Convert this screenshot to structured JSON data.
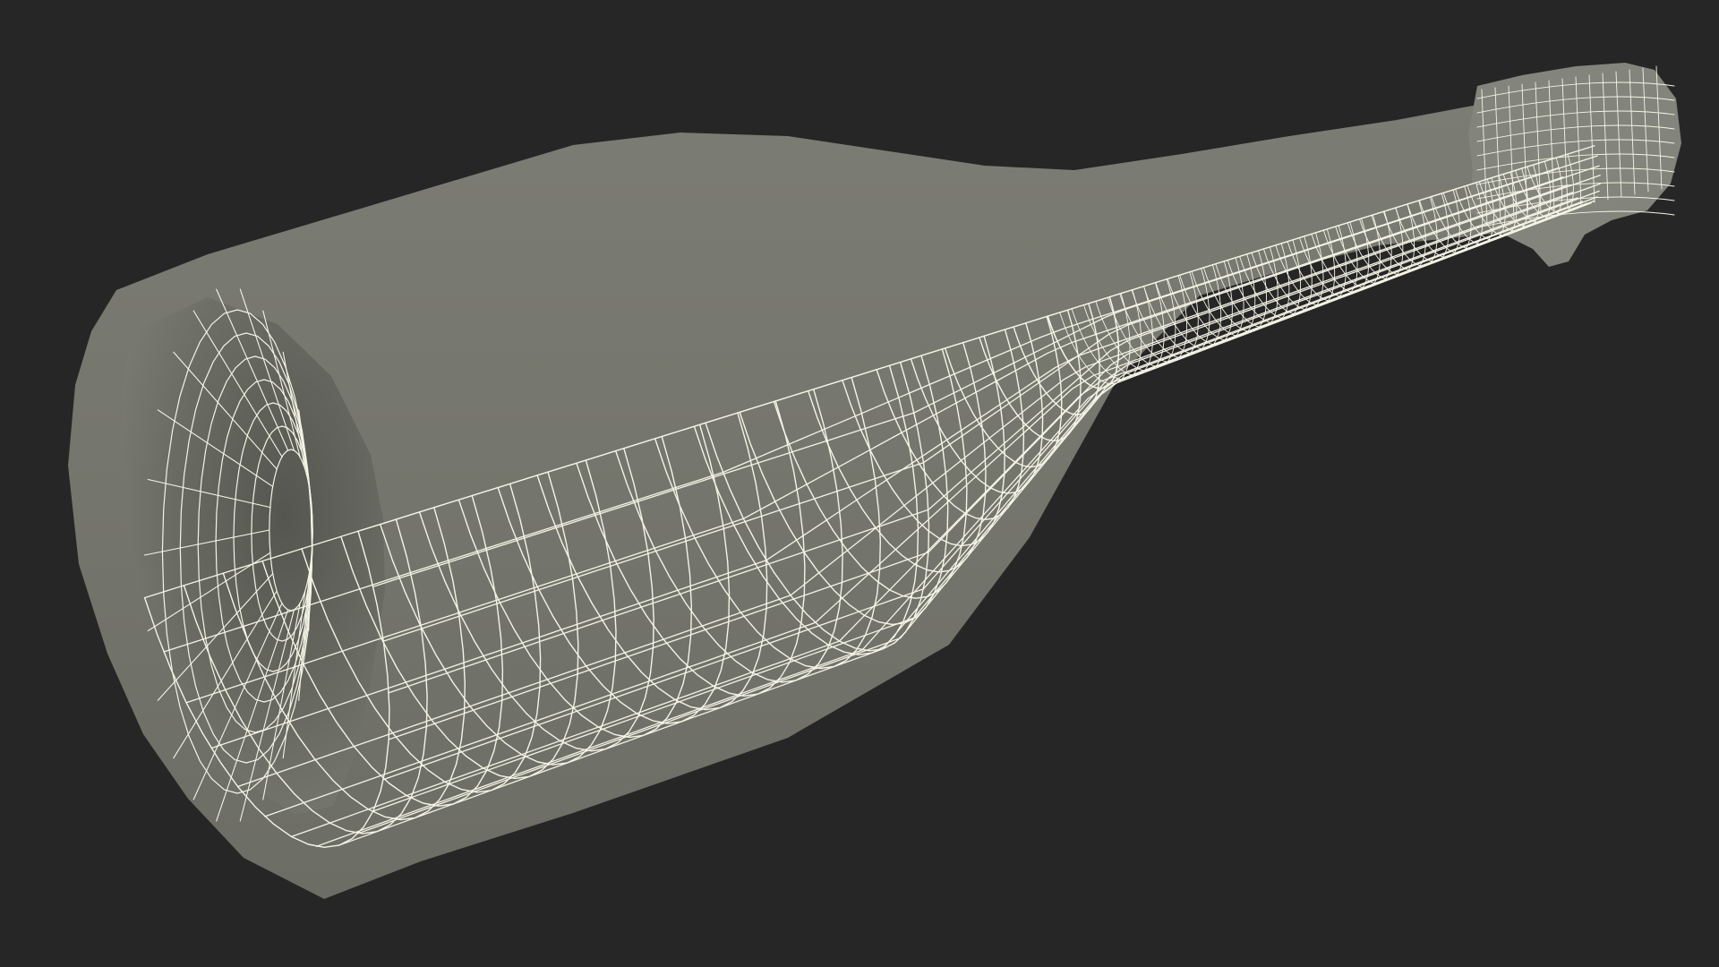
{
  "viewport": {
    "background_color": "#262626"
  },
  "model": {
    "subject": "bottle-wireframe-icon",
    "surface_color": "#75766d",
    "surface_dark_color": "#5f6059",
    "surface_light_color": "#83847b",
    "wire_color": "#f4f4e6",
    "render_mode": "wireframe-on-shaded"
  }
}
